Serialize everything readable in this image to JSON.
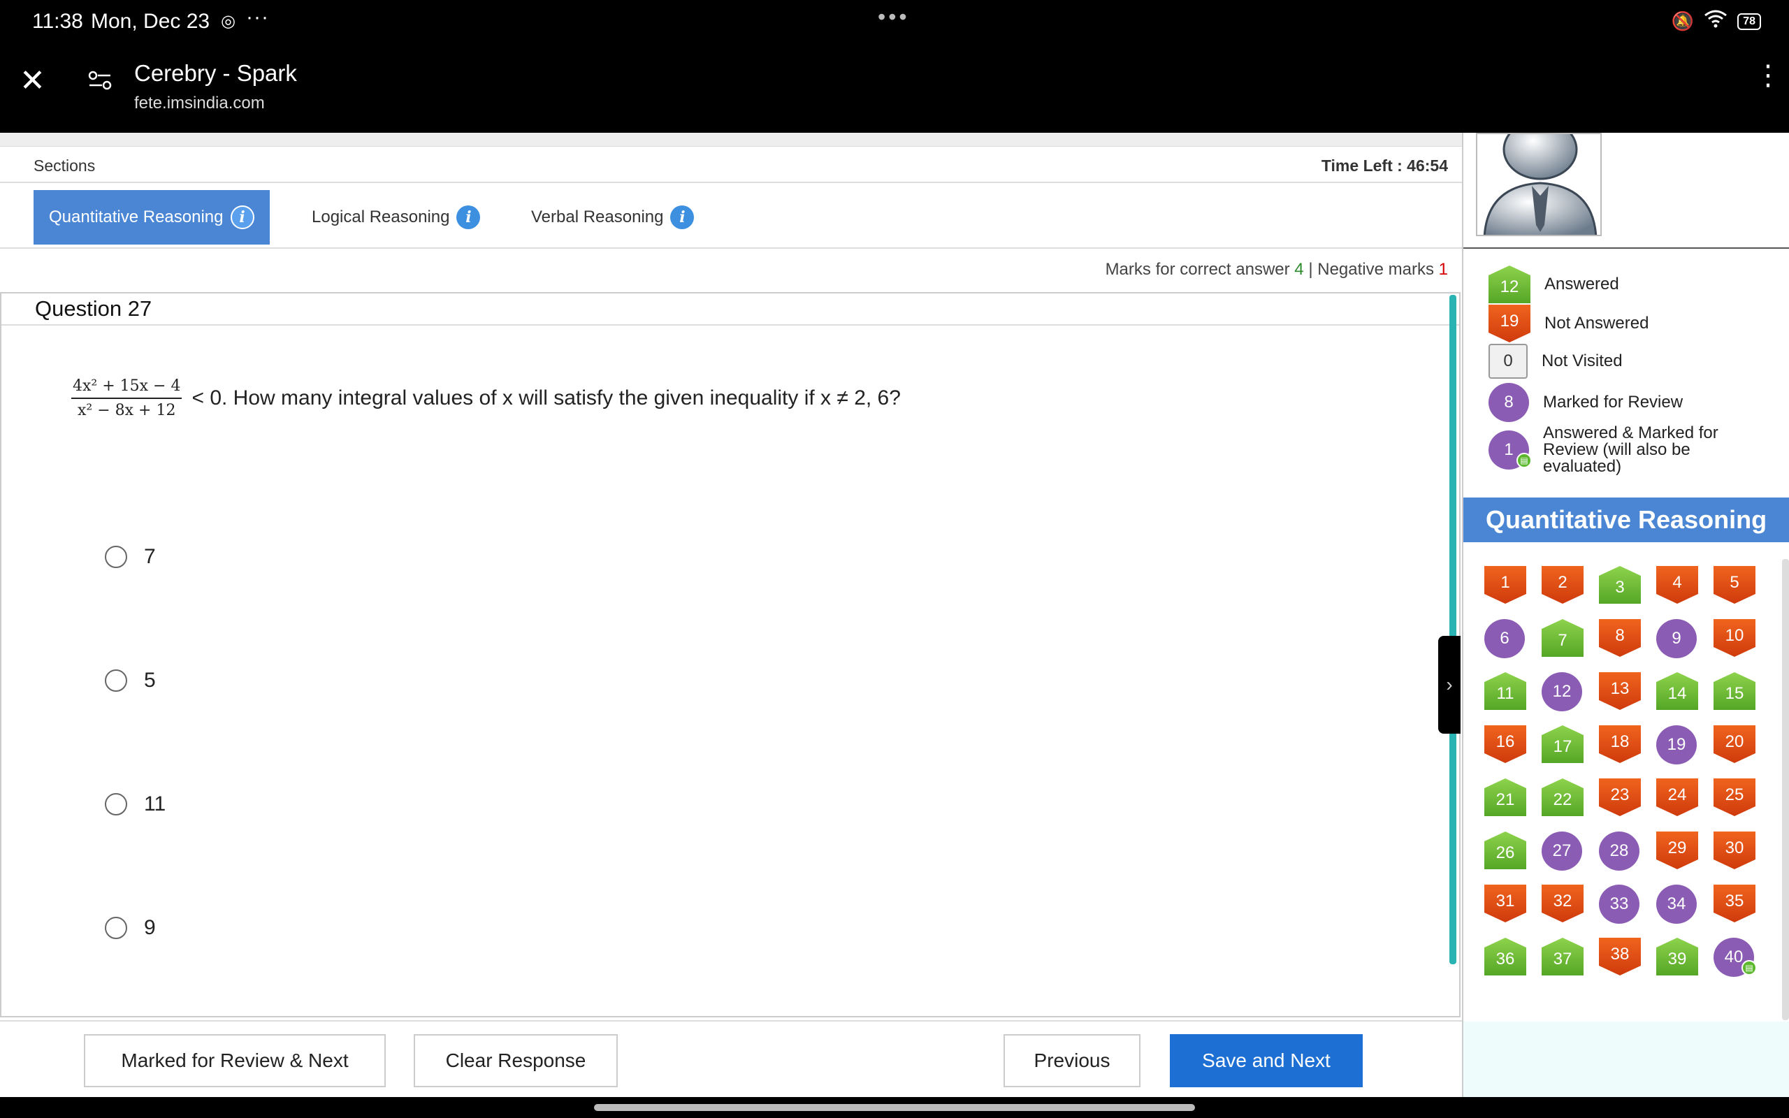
{
  "status_bar": {
    "time": "11:38",
    "date": "Mon, Dec 23",
    "battery": "78"
  },
  "browser": {
    "title": "Cerebry - Spark",
    "url": "fete.imsindia.com"
  },
  "header": {
    "sections_label": "Sections",
    "time_left": "Time Left : 46:54"
  },
  "tabs": [
    {
      "label": "Quantitative Reasoning",
      "active": true
    },
    {
      "label": "Logical Reasoning",
      "active": false
    },
    {
      "label": "Verbal Reasoning",
      "active": false
    }
  ],
  "marks": {
    "correct_label": "Marks for correct answer",
    "correct_value": "4",
    "separator": "|",
    "negative_label": "Negative marks",
    "negative_value": "1"
  },
  "question": {
    "title": "Question 27",
    "numerator": "4x² + 15x − 4",
    "denominator": "x² − 8x + 12",
    "text": "< 0. How many integral values of x will satisfy the given inequality if x ≠ 2, 6?",
    "options": [
      "7",
      "5",
      "11",
      "9"
    ]
  },
  "buttons": {
    "review_next": "Marked for Review & Next",
    "clear": "Clear Response",
    "previous": "Previous",
    "save_next": "Save and Next"
  },
  "legend": [
    {
      "count": "12",
      "label": "Answered",
      "status": "ans"
    },
    {
      "count": "19",
      "label": "Not Answered",
      "status": "notans"
    },
    {
      "count": "0",
      "label": "Not Visited",
      "status": "notvis"
    },
    {
      "count": "8",
      "label": "Marked for Review",
      "status": "review"
    },
    {
      "count": "1",
      "label": "Answered & Marked for Review (will also be evaluated)",
      "status": "review-ans"
    }
  ],
  "palette_title": "Quantitative Reasoning",
  "palette": [
    {
      "n": "1",
      "s": "notans"
    },
    {
      "n": "2",
      "s": "notans"
    },
    {
      "n": "3",
      "s": "ans"
    },
    {
      "n": "4",
      "s": "notans"
    },
    {
      "n": "5",
      "s": "notans"
    },
    {
      "n": "6",
      "s": "review"
    },
    {
      "n": "7",
      "s": "ans"
    },
    {
      "n": "8",
      "s": "notans"
    },
    {
      "n": "9",
      "s": "review"
    },
    {
      "n": "10",
      "s": "notans"
    },
    {
      "n": "11",
      "s": "ans"
    },
    {
      "n": "12",
      "s": "review"
    },
    {
      "n": "13",
      "s": "notans"
    },
    {
      "n": "14",
      "s": "ans"
    },
    {
      "n": "15",
      "s": "ans"
    },
    {
      "n": "16",
      "s": "notans"
    },
    {
      "n": "17",
      "s": "ans"
    },
    {
      "n": "18",
      "s": "notans"
    },
    {
      "n": "19",
      "s": "review"
    },
    {
      "n": "20",
      "s": "notans"
    },
    {
      "n": "21",
      "s": "ans"
    },
    {
      "n": "22",
      "s": "ans"
    },
    {
      "n": "23",
      "s": "notans"
    },
    {
      "n": "24",
      "s": "notans"
    },
    {
      "n": "25",
      "s": "notans"
    },
    {
      "n": "26",
      "s": "ans"
    },
    {
      "n": "27",
      "s": "review"
    },
    {
      "n": "28",
      "s": "review"
    },
    {
      "n": "29",
      "s": "notans"
    },
    {
      "n": "30",
      "s": "notans"
    },
    {
      "n": "31",
      "s": "notans"
    },
    {
      "n": "32",
      "s": "notans"
    },
    {
      "n": "33",
      "s": "review"
    },
    {
      "n": "34",
      "s": "review"
    },
    {
      "n": "35",
      "s": "notans"
    },
    {
      "n": "36",
      "s": "ans"
    },
    {
      "n": "37",
      "s": "ans"
    },
    {
      "n": "38",
      "s": "notans"
    },
    {
      "n": "39",
      "s": "ans"
    },
    {
      "n": "40",
      "s": "review-ans"
    }
  ],
  "colors": {
    "accent": "#4a86d4",
    "primary_button": "#1d6fd3",
    "answered": "#6cbf35",
    "not_answered": "#e04e14",
    "review": "#8a5cb4"
  }
}
